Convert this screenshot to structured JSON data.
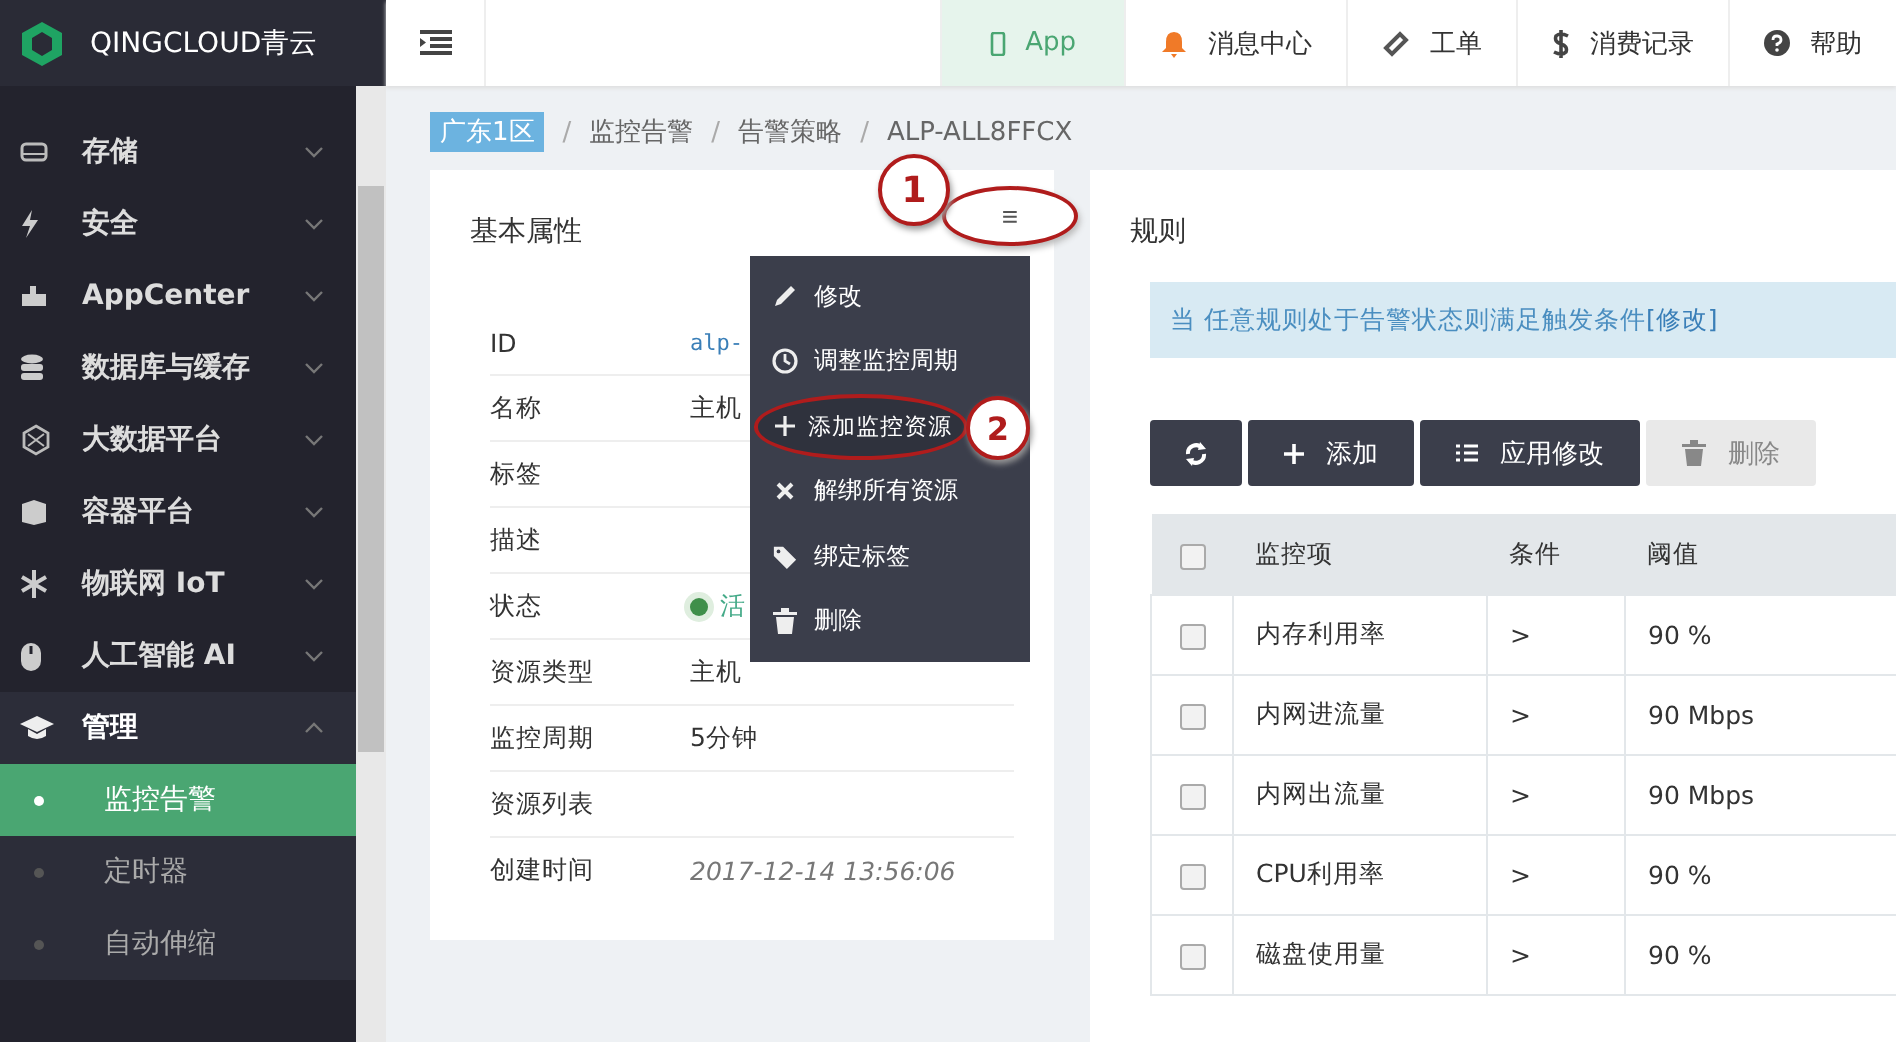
{
  "logo": {
    "text": "QINGCLOUD青云"
  },
  "topnav": [
    {
      "label": "App",
      "selected": true
    },
    {
      "label": "消息中心",
      "selected": false
    },
    {
      "label": "工单",
      "selected": false
    },
    {
      "label": "消费记录",
      "selected": false
    },
    {
      "label": "帮助",
      "selected": false
    }
  ],
  "sidebar": {
    "items": [
      {
        "label": "存储",
        "expanded": false
      },
      {
        "label": "安全",
        "expanded": false
      },
      {
        "label": "AppCenter",
        "expanded": false
      },
      {
        "label": "数据库与缓存",
        "expanded": false
      },
      {
        "label": "大数据平台",
        "expanded": false
      },
      {
        "label": "容器平台",
        "expanded": false
      },
      {
        "label": "物联网 IoT",
        "expanded": false
      },
      {
        "label": "人工智能 AI",
        "expanded": false
      },
      {
        "label": "管理",
        "expanded": true,
        "children": [
          {
            "label": "监控告警",
            "selected": true
          },
          {
            "label": "定时器",
            "selected": false
          },
          {
            "label": "自动伸缩",
            "selected": false
          }
        ]
      }
    ]
  },
  "breadcrumb": {
    "zone": "广东1区",
    "separator": "/",
    "items": [
      "监控告警",
      "告警策略",
      "ALP-ALL8FFCX"
    ]
  },
  "basic": {
    "title": "基本属性",
    "rows": [
      {
        "label": "ID",
        "value": "alp-",
        "kind": "mono"
      },
      {
        "label": "名称",
        "value": "主机",
        "kind": "text"
      },
      {
        "label": "标签"
      },
      {
        "label": "描述"
      },
      {
        "label": "状态",
        "value": "活",
        "kind": "status"
      },
      {
        "label": "资源类型",
        "value": "主机",
        "kind": "text"
      },
      {
        "label": "监控周期",
        "value": "5分钟",
        "kind": "text"
      },
      {
        "label": "资源列表"
      },
      {
        "label": "创建时间",
        "value": "2017-12-14 13:56:06",
        "kind": "time"
      }
    ]
  },
  "menu": {
    "button": "≡",
    "items": [
      {
        "label": "修改",
        "highlighted": false
      },
      {
        "label": "调整监控周期",
        "highlighted": false
      },
      {
        "label": "添加监控资源",
        "highlighted": true
      },
      {
        "label": "解绑所有资源",
        "highlighted": false
      },
      {
        "label": "绑定标签",
        "highlighted": false
      },
      {
        "label": "删除",
        "highlighted": false
      }
    ]
  },
  "callouts": [
    "1",
    "2"
  ],
  "rules": {
    "title": "规则",
    "notice": "当 任意规则处于告警状态则满足触发条件",
    "notice_link": "[修改]",
    "buttons": [
      {
        "disabled": false
      },
      {
        "label": "添加",
        "disabled": false
      },
      {
        "label": "应用修改",
        "disabled": false
      },
      {
        "label": "删除",
        "disabled": true
      }
    ],
    "header_checked": false,
    "columns": [
      "监控项",
      "条件",
      "阈值"
    ],
    "rows": [
      {
        "checked": false,
        "cells": [
          "内存利用率",
          ">",
          "90 %"
        ]
      },
      {
        "checked": false,
        "cells": [
          "内网进流量",
          ">",
          "90 Mbps"
        ]
      },
      {
        "checked": false,
        "cells": [
          "内网出流量",
          ">",
          "90 Mbps"
        ]
      },
      {
        "checked": false,
        "cells": [
          "CPU利用率",
          ">",
          "90 %"
        ]
      },
      {
        "checked": false,
        "cells": [
          "磁盘使用量",
          ">",
          "90 %"
        ]
      }
    ]
  }
}
